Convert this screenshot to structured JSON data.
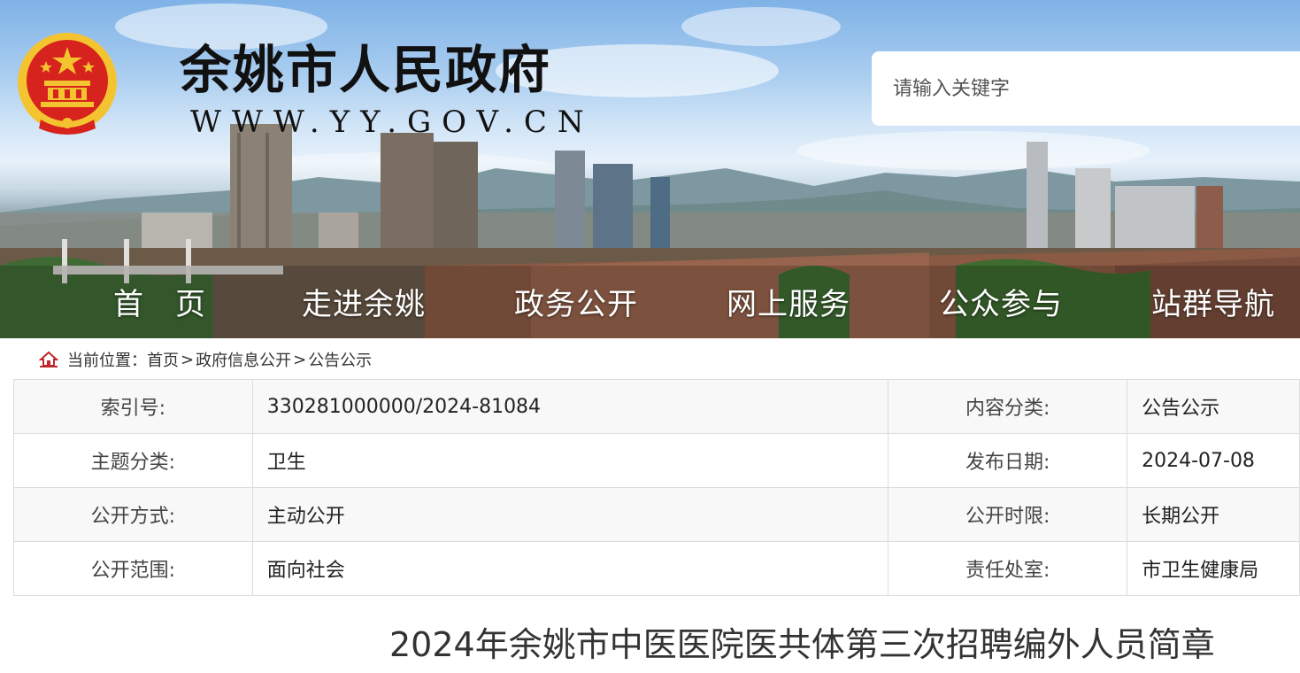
{
  "header": {
    "site_title": "余姚市人民政府",
    "site_url": "WWW.YY.GOV.CN",
    "search_placeholder": "请输入关键字"
  },
  "nav": {
    "items": [
      {
        "label": "首　页"
      },
      {
        "label": "走进余姚"
      },
      {
        "label": "政务公开"
      },
      {
        "label": "网上服务"
      },
      {
        "label": "公众参与"
      },
      {
        "label": "站群导航"
      }
    ]
  },
  "breadcrumb": {
    "prefix": "当前位置：",
    "items": [
      "首页",
      "政府信息公开",
      "公告公示"
    ],
    "separator": ">"
  },
  "info_table": {
    "rows": [
      {
        "label1": "索引号:",
        "value1": "330281000000/2024-81084",
        "label2": "内容分类:",
        "value2": "公告公示"
      },
      {
        "label1": "主题分类:",
        "value1": "卫生",
        "label2": "发布日期:",
        "value2": "2024-07-08"
      },
      {
        "label1": "公开方式:",
        "value1": "主动公开",
        "label2": "公开时限:",
        "value2": "长期公开"
      },
      {
        "label1": "公开范围:",
        "value1": "面向社会",
        "label2": "责任处室:",
        "value2": "市卫生健康局"
      }
    ]
  },
  "article": {
    "title": "2024年余姚市中医医院医共体第三次招聘编外人员简章"
  },
  "colors": {
    "emblem_red": "#d7231d",
    "emblem_gold": "#f4c430",
    "breadcrumb_icon": "#c0282d",
    "table_border": "#dcdcdc"
  }
}
